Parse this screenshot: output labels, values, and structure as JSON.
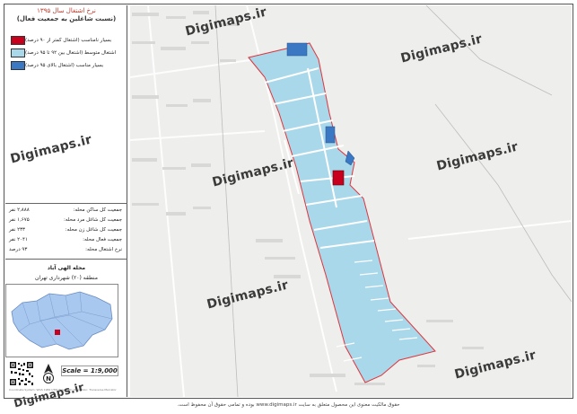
{
  "legend": {
    "title": "نرخ اشتغال سال ۱۳۹۵",
    "subtitle": "(نسبت شاغلین به جمعیت فعال)",
    "items": [
      {
        "label": "بسیار نامناسب (اشتغال کمتر از ۹۰ درصد)",
        "color": "#c8001e",
        "icon": "legend-swatch-red"
      },
      {
        "label": "اشتغال متوسط (اشتغال بین ۹۲ تا ۹۵ درصد)",
        "color": "#a8d8ea",
        "icon": "legend-swatch-lightblue"
      },
      {
        "label": "بسیار مناسب (اشتغال بالای ۹۵ درصد)",
        "color": "#3b78c4",
        "icon": "legend-swatch-blue"
      }
    ]
  },
  "stats": [
    {
      "key": "جمعیت کل ساکن محله:",
      "value": "۲,۸۸۸ نفر"
    },
    {
      "key": "جمعیت کل شاغل مرد محله:",
      "value": "۱,۶۷۵ نفر"
    },
    {
      "key": "جمعیت کل شاغل زن محله:",
      "value": "۲۳۳ نفر"
    },
    {
      "key": "جمعیت فعال محله:",
      "value": "۲۰۴۱ نفر"
    },
    {
      "key": "نرخ اشتغال محله:",
      "value": "۹۳ درصد"
    }
  ],
  "area": {
    "neighborhood": "محله الهی آباد",
    "district": "منطقه (۲۰) شهرداری تهران"
  },
  "scale_text": "Scale = 1:9,000",
  "coord_note": "Coordinate System: WGS 1984 UTM Zone 39N | Projection: Transverse Mercator",
  "watermark_text": "Digimaps.ir",
  "footer_text": "حقوق مالکیت معنوی این محصول متعلق به سایت www.digimaps.ir بوده و تمامی حقوق آن محفوظ است.",
  "colors": {
    "low": "#c8001e",
    "medium": "#a8d8ea",
    "high": "#3b78c4",
    "boundary": "#e0343c",
    "map_bg": "#eeeeec"
  }
}
